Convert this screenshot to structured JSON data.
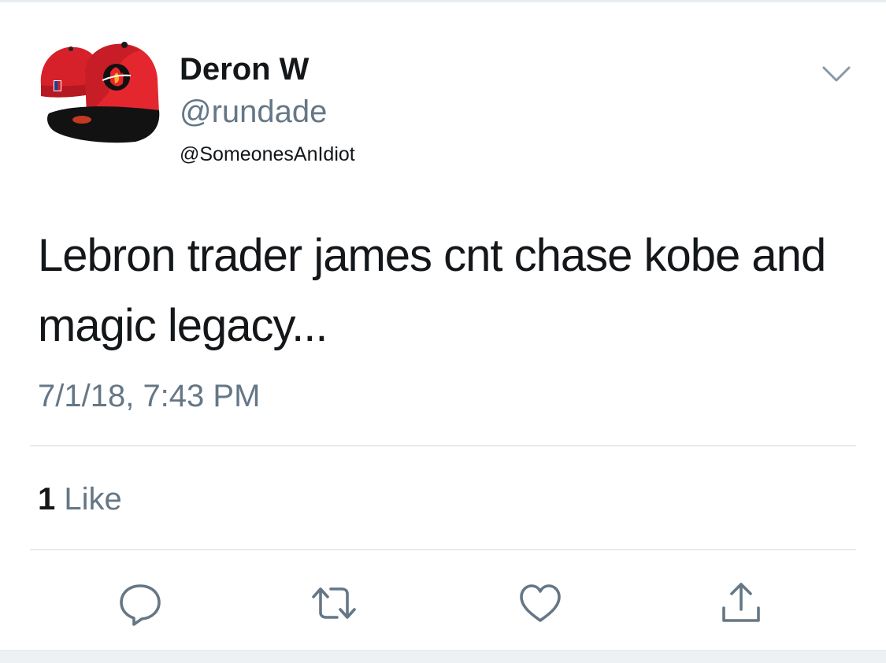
{
  "tweet": {
    "author": {
      "display_name": "Deron W",
      "handle": "@rundade",
      "avatar_icon": "red-black-snapback-hat-avatar"
    },
    "reply_to": "@SomeonesAnIdiot",
    "text": "Lebron trader james cnt chase kobe and magic legacy...",
    "timestamp": "7/1/18, 7:43 PM"
  },
  "stats": {
    "likes_count": "1",
    "likes_label": "Like"
  },
  "actions": [
    {
      "name": "reply",
      "icon": "reply-icon"
    },
    {
      "name": "retweet",
      "icon": "retweet-icon"
    },
    {
      "name": "like",
      "icon": "heart-icon"
    },
    {
      "name": "share",
      "icon": "share-icon"
    }
  ],
  "colors": {
    "primary_text": "#14171a",
    "secondary_text": "#657786",
    "divider": "#e6ecf0",
    "icon_stroke": "#657786"
  }
}
